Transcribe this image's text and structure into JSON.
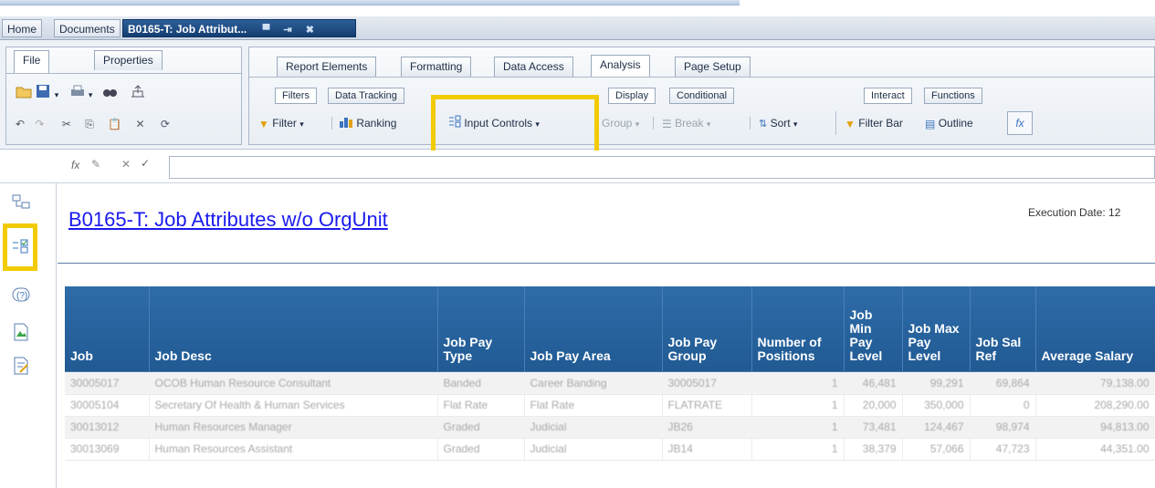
{
  "doc_tabs": {
    "home": "Home",
    "documents": "Documents",
    "active": "B0165-T: Job Attribut..."
  },
  "ribbon": {
    "left_tabs": [
      "File",
      "Properties"
    ],
    "main_tabs": [
      "Report Elements",
      "Formatting",
      "Data Access",
      "Analysis",
      "Page Setup"
    ],
    "sub_tabs": [
      "Filters",
      "Data Tracking",
      "Display",
      "Conditional",
      "Interact",
      "Functions"
    ],
    "buttons": {
      "filter": "Filter",
      "ranking": "Ranking",
      "input_controls": "Input Controls",
      "group": "Group",
      "break": "Break",
      "sort": "Sort",
      "filter_bar": "Filter Bar",
      "outline": "Outline"
    }
  },
  "report": {
    "title": "B0165-T: Job Attributes w/o OrgUnit",
    "execution_date": "Execution Date: 12",
    "columns": [
      "Job",
      "Job Desc",
      "Job Pay Type",
      "Job Pay Area",
      "Job Pay Group",
      "Number of Positions",
      "Job Min Pay Level",
      "Job Max Pay Level",
      "Job Sal Ref",
      "Average Salary"
    ],
    "rows": [
      [
        "30005017",
        "OCOB Human Resource Consultant",
        "Banded",
        "Career Banding",
        "30005017",
        "1",
        "46,481",
        "99,291",
        "69,864",
        "79,138.00"
      ],
      [
        "30005104",
        "Secretary Of Health & Human Services",
        "Flat Rate",
        "Flat Rate",
        "FLATRATE",
        "1",
        "20,000",
        "350,000",
        "0",
        "208,290.00"
      ],
      [
        "30013012",
        "Human Resources Manager",
        "Graded",
        "Judicial",
        "JB26",
        "1",
        "73,481",
        "124,467",
        "98,974",
        "94,813.00"
      ],
      [
        "30013069",
        "Human Resources Assistant",
        "Graded",
        "Judicial",
        "JB14",
        "1",
        "38,379",
        "57,066",
        "47,723",
        "44,351.00"
      ]
    ]
  },
  "colors": {
    "highlight": "#f2cb05",
    "header_bg": "#2a64a0",
    "active_doc_tab": "#1f4f86",
    "title_link": "#1a1aee"
  }
}
